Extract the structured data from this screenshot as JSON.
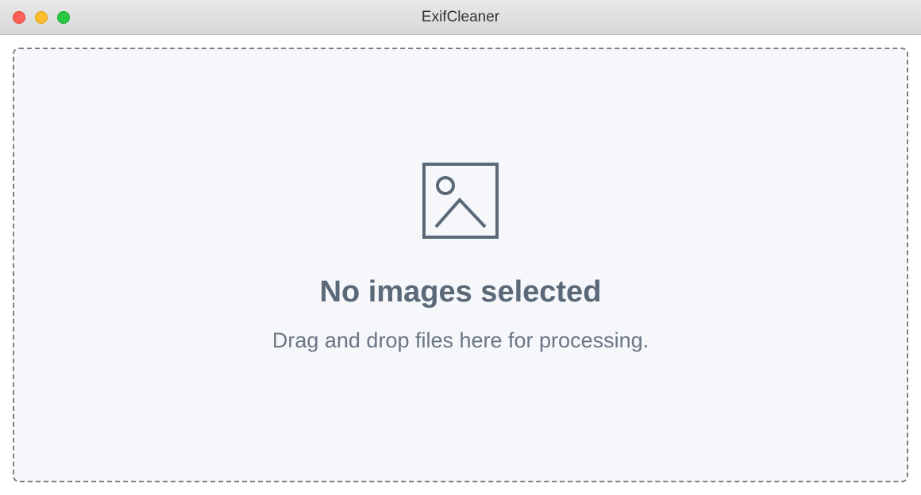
{
  "window": {
    "title": "ExifCleaner"
  },
  "dropzone": {
    "heading": "No images selected",
    "subtext": "Drag and drop files here for processing."
  }
}
